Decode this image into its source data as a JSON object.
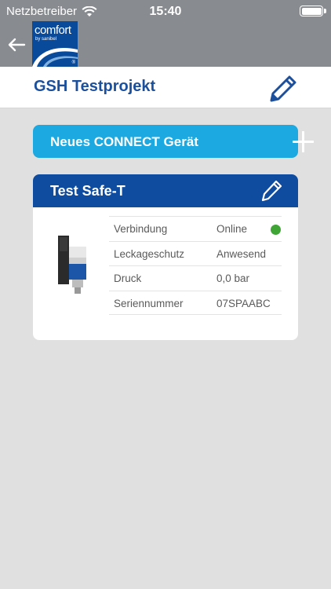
{
  "status_bar": {
    "carrier": "Netzbetreiber",
    "time": "15:40"
  },
  "header": {
    "logo_brand": "comfort",
    "logo_sub": "by sanibel",
    "logo_reg": "®",
    "title": "GSH Testprojekt"
  },
  "add_device": {
    "label": "Neues CONNECT Gerät"
  },
  "device_card": {
    "name": "Test Safe-T",
    "rows": [
      {
        "key": "Verbindung",
        "value": "Online"
      },
      {
        "key": "Leckageschutz",
        "value": "Anwesend"
      },
      {
        "key": "Druck",
        "value": "0,0 bar"
      },
      {
        "key": "Seriennummer",
        "value": "07SPAABC"
      }
    ],
    "online_color": "#3fa535"
  },
  "colors": {
    "topbar": "#888c90",
    "brand_blue": "#0f4c9f",
    "accent_cyan": "#1ca8e0",
    "title_blue": "#1c4f9c"
  },
  "icons": [
    "wifi-icon",
    "battery-icon",
    "back-arrow-icon",
    "pencil-icon",
    "plus-icon"
  ]
}
